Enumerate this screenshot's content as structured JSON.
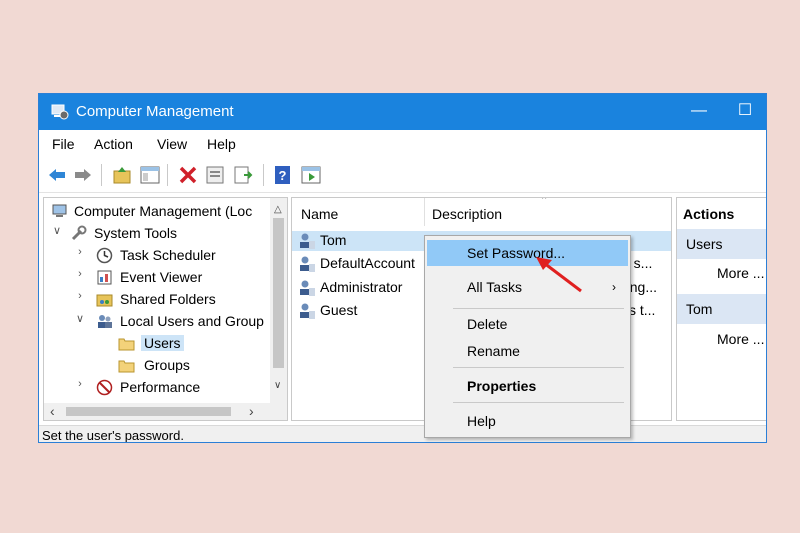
{
  "window": {
    "title": "Computer Management",
    "minimize": "—",
    "maximize": "☐"
  },
  "menu": [
    "File",
    "Action",
    "View",
    "Help"
  ],
  "tree": {
    "root": "Computer Management (Loc",
    "system_tools": "System Tools",
    "task_scheduler": "Task Scheduler",
    "event_viewer": "Event Viewer",
    "shared_folders": "Shared Folders",
    "local_users": "Local Users and Group",
    "users": "Users",
    "groups": "Groups",
    "performance": "Performance"
  },
  "list": {
    "col_name": "Name",
    "col_description": "Description",
    "rows": [
      {
        "name": "Tom",
        "desc": ""
      },
      {
        "name": "DefaultAccount",
        "desc": "e s..."
      },
      {
        "name": "Administrator",
        "desc": "ring..."
      },
      {
        "name": "Guest",
        "desc": "ss t..."
      }
    ]
  },
  "actions": {
    "header": "Actions",
    "section1": "Users",
    "more1": "More ...",
    "section2": "Tom",
    "more2": "More ..."
  },
  "context_menu": {
    "set_password": "Set Password...",
    "all_tasks": "All Tasks",
    "delete": "Delete",
    "rename": "Rename",
    "properties": "Properties",
    "help": "Help"
  },
  "status": "Set the user's password.",
  "colors": {
    "titlebar": "#1a83de",
    "selection": "#cce4f7",
    "menu_highlight": "#91c9f7",
    "annotation_arrow": "#e02020"
  }
}
